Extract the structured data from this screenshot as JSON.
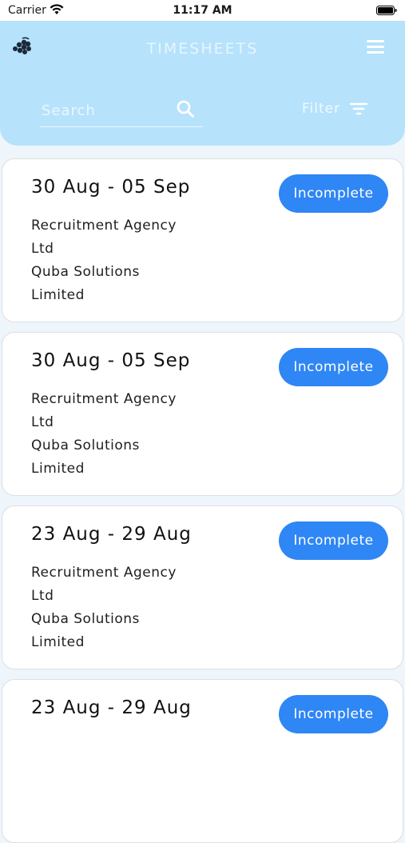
{
  "status_bar": {
    "carrier": "Carrier",
    "time": "11:17 AM"
  },
  "header": {
    "title": "TIMESHEETS",
    "search_placeholder": "Search",
    "filter_label": "Filter"
  },
  "timesheets": [
    {
      "date_range": "30 Aug - 05 Sep",
      "agency_line1": "Recruitment Agency",
      "agency_line2": "Ltd",
      "client_line1": "Quba Solutions",
      "client_line2": "Limited",
      "status": "Incomplete"
    },
    {
      "date_range": "30 Aug - 05 Sep",
      "agency_line1": "Recruitment Agency",
      "agency_line2": "Ltd",
      "client_line1": "Quba Solutions",
      "client_line2": "Limited",
      "status": "Incomplete"
    },
    {
      "date_range": "23 Aug - 29 Aug",
      "agency_line1": "Recruitment Agency",
      "agency_line2": "Ltd",
      "client_line1": "Quba Solutions",
      "client_line2": "Limited",
      "status": "Incomplete"
    },
    {
      "date_range": "23 Aug - 29 Aug",
      "agency_line1": "",
      "agency_line2": "",
      "client_line1": "",
      "client_line2": "",
      "status": "Incomplete"
    }
  ],
  "icons": {
    "logo": "grape-logo-icon",
    "menu": "hamburger-menu-icon",
    "search": "search-icon",
    "filter": "filter-icon",
    "wifi": "wifi-icon",
    "battery": "battery-icon"
  },
  "colors": {
    "header_bg": "#b6e2fb",
    "badge_bg": "#2f86f5",
    "page_bg": "#eef5fb"
  }
}
